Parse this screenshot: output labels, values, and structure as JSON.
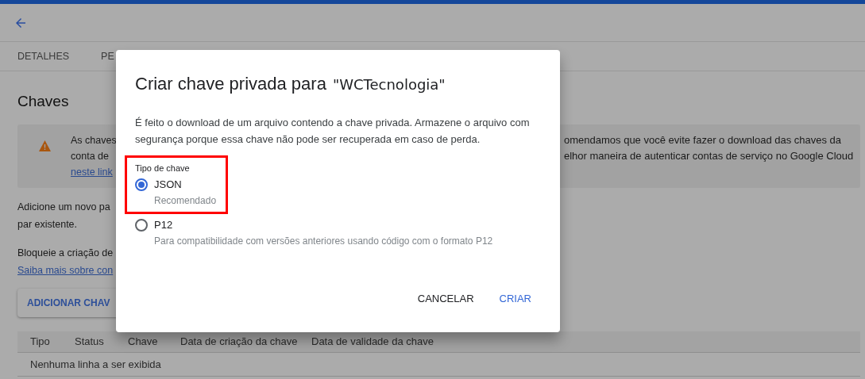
{
  "tabs": [
    {
      "label": "DETALHES"
    },
    {
      "label": "PE"
    }
  ],
  "page": {
    "heading": "Chaves",
    "warning": {
      "left_lines": [
        "As chaves",
        "conta de"
      ],
      "link": "neste link",
      "right_lines": [
        "omendamos que você evite fazer o download das chaves da",
        "elhor maneira de autenticar contas de serviço no Google Cloud"
      ]
    },
    "add_text": [
      "Adicione um novo pa",
      "par existente."
    ],
    "block_text": "Bloqueie a criação de",
    "learn_link": "Saiba mais sobre con",
    "add_button": "ADICIONAR CHAV",
    "table": {
      "columns": [
        "Tipo",
        "Status",
        "Chave",
        "Data de criação da chave",
        "Data de validade da chave"
      ],
      "empty_message": "Nenhuma linha a ser exibida"
    }
  },
  "dialog": {
    "title": "Criar chave privada para",
    "account_name": "\"WCTecnologia\"",
    "description": "É feito o download de um arquivo contendo a chave privada. Armazene o arquivo com segurança porque essa chave não pode ser recuperada em caso de perda.",
    "key_type": {
      "label": "Tipo de chave",
      "options": [
        {
          "label": "JSON",
          "hint": "Recomendado",
          "selected": true,
          "highlighted": true
        },
        {
          "label": "P12",
          "hint": "Para compatibilidade com versões anteriores usando código com o formato P12",
          "selected": false,
          "highlighted": false
        }
      ]
    },
    "buttons": [
      {
        "label": "CANCELAR",
        "kind": "secondary"
      },
      {
        "label": "CRIAR",
        "kind": "primary"
      }
    ]
  }
}
